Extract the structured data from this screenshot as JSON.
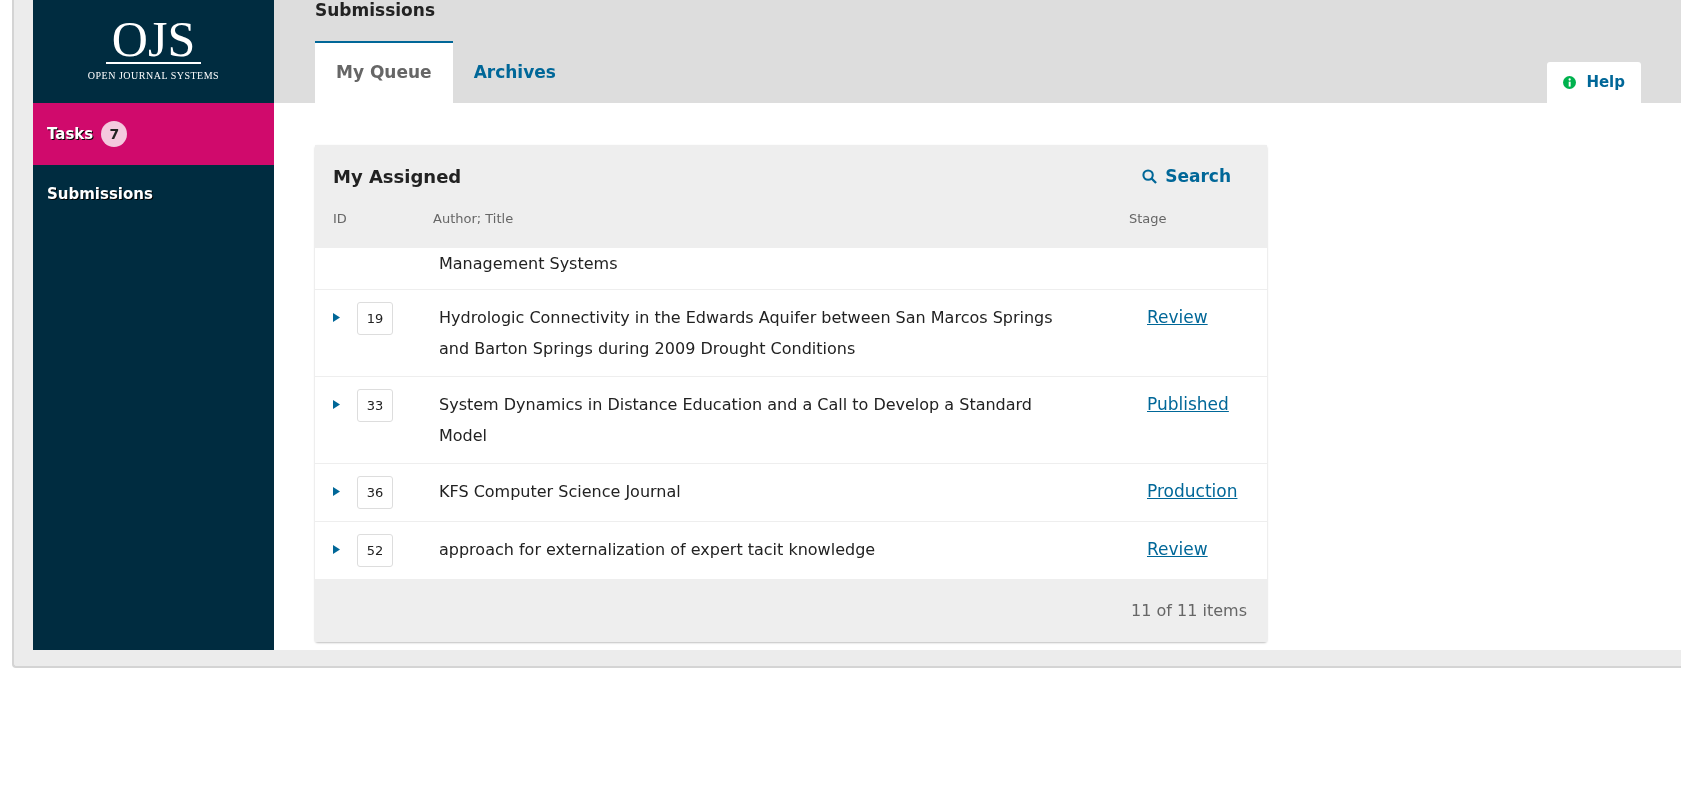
{
  "logo": {
    "mark": "OJS",
    "caption": "OPEN JOURNAL SYSTEMS"
  },
  "sidebar": {
    "items": [
      {
        "label": "Tasks",
        "badge": "7",
        "selected": true
      },
      {
        "label": "Submissions",
        "selected": false
      }
    ]
  },
  "page_title": "Submissions",
  "tabs": [
    {
      "label": "My Queue",
      "selected": true
    },
    {
      "label": "Archives",
      "selected": false
    }
  ],
  "help": {
    "label": "Help"
  },
  "panel": {
    "title": "My Assigned",
    "search": "Search",
    "columns": [
      "ID",
      "Author; Title",
      "Stage"
    ],
    "rows": [
      {
        "partial": true,
        "title": "Management Systems"
      },
      {
        "id": "19",
        "title": "Hydrologic Connectivity in the Edwards Aquifer between San Marcos Springs and Barton Springs during 2009 Drought Conditions",
        "stage": "Review",
        "expanded": false
      },
      {
        "id": "33",
        "title": "System Dynamics in Distance Education and a Call to Develop a Standard Model",
        "stage": "Published",
        "expanded": false
      },
      {
        "id": "36",
        "title": "KFS Computer Science Journal",
        "stage": "Production",
        "expanded": false
      },
      {
        "id": "52",
        "title": "approach for externalization of expert tacit knowledge",
        "stage": "Review",
        "expanded": false
      }
    ],
    "footer": "11 of 11 items"
  }
}
